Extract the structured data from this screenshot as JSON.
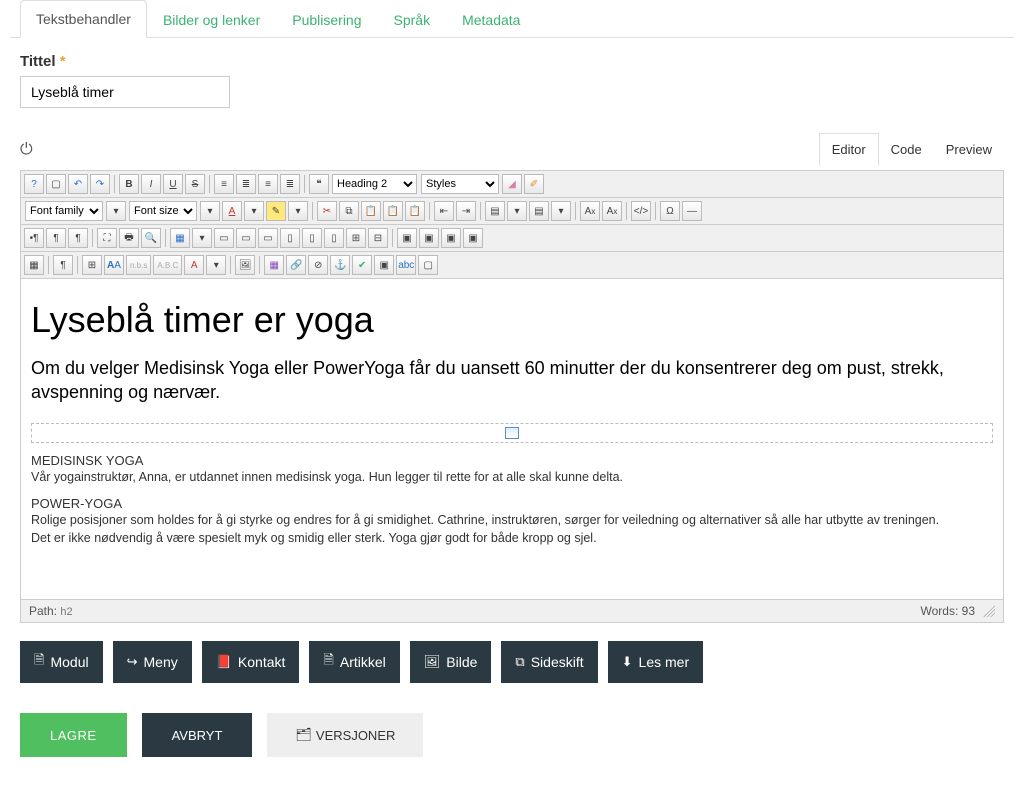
{
  "tabs": {
    "active": "Tekstbehandler",
    "items": [
      "Tekstbehandler",
      "Bilder og lenker",
      "Publisering",
      "Språk",
      "Metadata"
    ]
  },
  "title_field": {
    "label": "Tittel",
    "required_mark": "*",
    "value": "Lyseblå timer"
  },
  "editor_modes": {
    "active": "Editor",
    "items": [
      "Editor",
      "Code",
      "Preview"
    ]
  },
  "toolbar": {
    "format_select": "Heading 2",
    "styles_select": "Styles",
    "fontfamily_select": "Font family",
    "fontsize_select": "Font size"
  },
  "content": {
    "heading": "Lyseblå timer er yoga",
    "lead": "Om du velger Medisinsk Yoga eller PowerYoga får du uansett 60 minutter der du konsentrerer deg om pust, strekk, avspenning og nærvær.",
    "sections": [
      {
        "title": "MEDISINSK YOGA",
        "body": "Vår yogainstruktør, Anna, er utdannet innen medisinsk yoga. Hun legger til rette for at alle skal kunne delta."
      },
      {
        "title": "POWER-YOGA",
        "body": "Rolige posisjoner som holdes for å gi styrke og endres for å gi smidighet. Cathrine, instruktøren, sørger for veiledning og alternativer så alle har utbytte av treningen.\nDet er ikke nødvendig å være spesielt myk og smidig eller sterk. Yoga gjør godt for både kropp og sjel."
      }
    ]
  },
  "status": {
    "path_label": "Path:",
    "path_value": "h2",
    "words_label": "Words:",
    "words_value": "93"
  },
  "actions": {
    "module": "Modul",
    "menu": "Meny",
    "contact": "Kontakt",
    "article": "Artikkel",
    "image": "Bilde",
    "pagebreak": "Sideskift",
    "readmore": "Les mer"
  },
  "bottom": {
    "save": "LAGRE",
    "cancel": "AVBRYT",
    "versions": "VERSJONER"
  }
}
